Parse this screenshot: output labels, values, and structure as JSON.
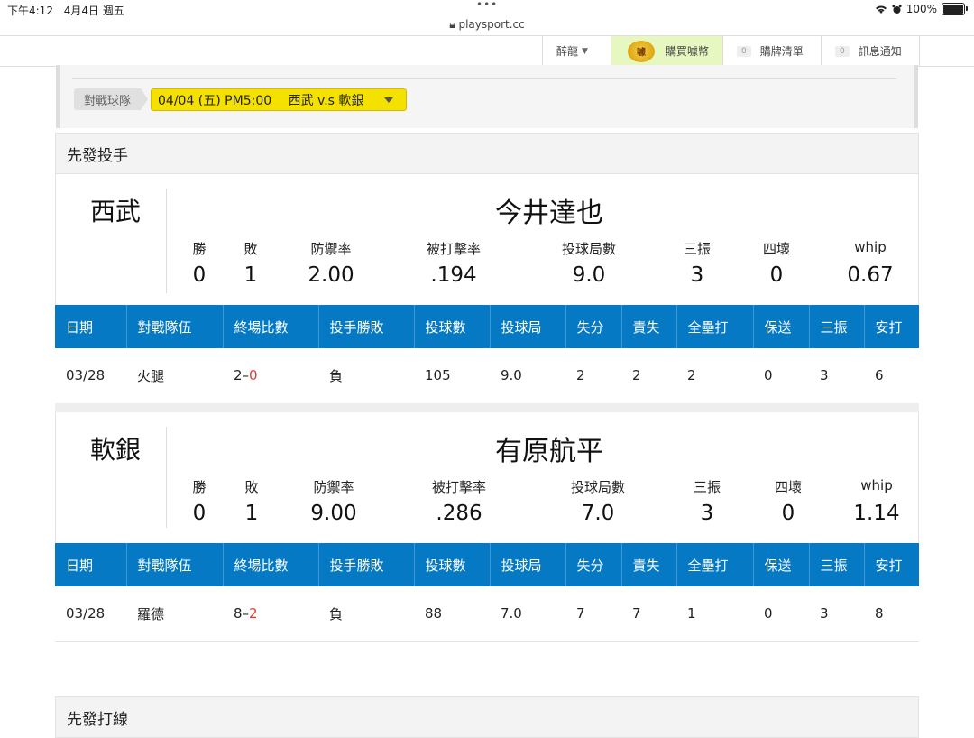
{
  "status_bar": {
    "time": "下午4:12",
    "date": "4月4日 週五",
    "battery": "100%",
    "url": "playsport.cc",
    "dots": "•••"
  },
  "nav": {
    "user": "醉龍",
    "buy_label": "購買噱幣",
    "coin_text": "噱",
    "cart_count": "0",
    "cart_label": "購牌清單",
    "notify_count": "0",
    "notify_label": "訊息通知"
  },
  "match": {
    "label": "對戰球隊",
    "selected": "04/04 (五) PM5:00　 西武 v.s 軟銀"
  },
  "section_pitchers": "先發投手",
  "section_lineup": "先發打線",
  "stat_labels": [
    "勝",
    "敗",
    "防禦率",
    "被打擊率",
    "投球局數",
    "三振",
    "四壞",
    "whip"
  ],
  "table_headers": [
    "日期",
    "對戰隊伍",
    "終場比數",
    "投手勝敗",
    "投球數",
    "投球局",
    "失分",
    "責失",
    "全壘打",
    "保送",
    "三振",
    "安打"
  ],
  "pitchers": [
    {
      "team": "西武",
      "name": "今井達也",
      "stats": [
        "0",
        "1",
        "2.00",
        ".194",
        "9.0",
        "3",
        "0",
        "0.67"
      ],
      "games": [
        {
          "date": "03/28",
          "opponent": "火腿",
          "score_own": "2",
          "score_dash": "–",
          "score_opp": "0",
          "result": "負",
          "pitches": "105",
          "innings": "9.0",
          "runs": "2",
          "earned": "2",
          "hr": "2",
          "bb": "0",
          "so": "3",
          "hits": "6"
        }
      ]
    },
    {
      "team": "軟銀",
      "name": "有原航平",
      "stats": [
        "0",
        "1",
        "9.00",
        ".286",
        "7.0",
        "3",
        "0",
        "1.14"
      ],
      "games": [
        {
          "date": "03/28",
          "opponent": "羅德",
          "score_own": "8",
          "score_dash": "–",
          "score_opp": "2",
          "result": "負",
          "pitches": "88",
          "innings": "7.0",
          "runs": "7",
          "earned": "7",
          "hr": "1",
          "bb": "0",
          "so": "3",
          "hits": "8"
        }
      ]
    }
  ],
  "colors": {
    "table_header_bg": "#0579c4",
    "selector_bg": "#f5e100",
    "loss_red": "#e23b2e",
    "buy_bg": "#e6f7c0"
  }
}
